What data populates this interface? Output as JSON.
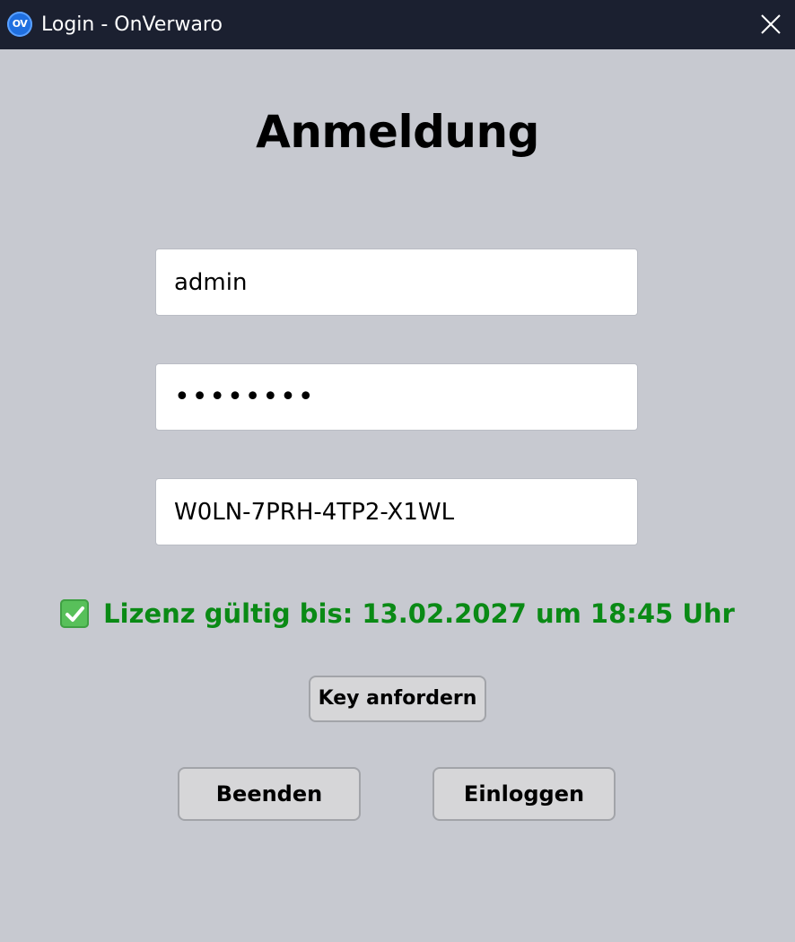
{
  "window": {
    "title": "Login - OnVerwaro",
    "icon_text": "OV",
    "close_icon": "close-icon"
  },
  "form": {
    "heading": "Anmeldung",
    "username": {
      "value": "admin"
    },
    "password": {
      "value": "••••••••"
    },
    "license_key": {
      "value": "W0LN-7PRH-4TP2-X1WL"
    }
  },
  "license_status": {
    "icon": "check-mark-button-icon",
    "text": "Lizenz gültig bis: 13.02.2027 um 18:45 Uhr",
    "color": "#0a8a15"
  },
  "buttons": {
    "request_key": "Key anfordern",
    "quit": "Beenden",
    "login": "Einloggen"
  },
  "colors": {
    "titlebar": "#1b2030",
    "background": "#c7c9d0",
    "button_bg": "#d6d6d8"
  }
}
